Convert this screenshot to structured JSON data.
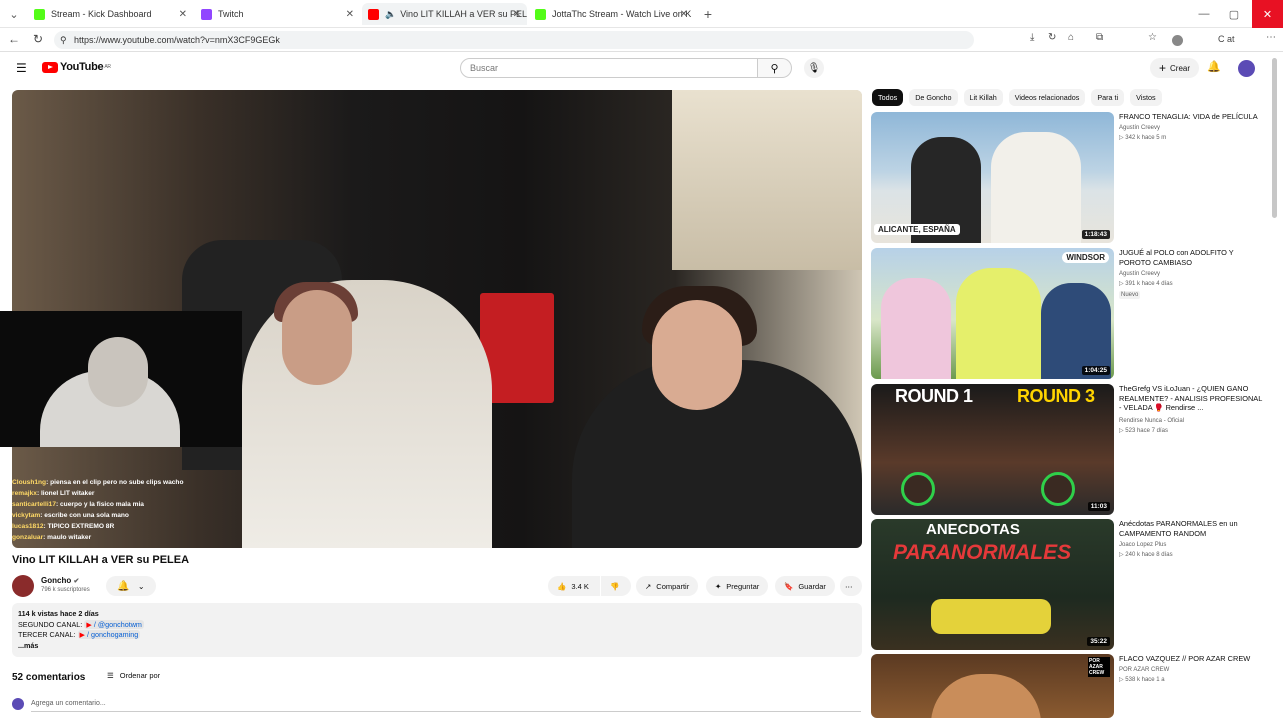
{
  "browser": {
    "tabs": [
      {
        "title": "Stream - Kick Dashboard",
        "favicon": "kick-icon",
        "color": "#53fc18"
      },
      {
        "title": "Twitch",
        "favicon": "twitch-icon",
        "color": "#9146ff"
      },
      {
        "title": "Vino LIT KILLAH a VER su PEL",
        "favicon": "youtube-icon",
        "color": "#ff0000"
      },
      {
        "title": "JottaThc Stream - Watch Live on K",
        "favicon": "kick-icon",
        "color": "#53fc18"
      }
    ],
    "url": "https://www.youtube.com/watch?v=nmX3CF9GEGk",
    "profile_text": "C at"
  },
  "youtube": {
    "logo_text": "YouTube",
    "logo_country": "AR",
    "search_placeholder": "Buscar",
    "create_label": "Crear"
  },
  "video": {
    "title": "Vino LIT KILLAH a VER su PELEA",
    "channel": "Goncho",
    "subscribers": "796 k suscriptores",
    "likes": "3.4 K",
    "share_label": "Compartir",
    "ask_label": "Preguntar",
    "save_label": "Guardar",
    "chat": [
      {
        "user": "Cloush1ng",
        "msg": "piensa en el clip pero no sube clips wacho"
      },
      {
        "user": "remajkx",
        "msg": "lionel LIT witaker"
      },
      {
        "user": "santicartelli17",
        "msg": "cuerpo y la fisico mala mia"
      },
      {
        "user": "vickytam",
        "msg": "escribe con una sola mano"
      },
      {
        "user": "lucas1812",
        "msg": "TIPICO EXTREMO 8R"
      },
      {
        "user": "gonzaluar",
        "msg": "maulo witaker"
      }
    ]
  },
  "description": {
    "views_date": "114 k vistas  hace 2 días",
    "line2_label": "SEGUNDO CANAL:",
    "line2_value": "/ @gonchotwm",
    "line3_label": "TERCER CANAL:",
    "line3_value": "/ gonchogaming",
    "more": "...más"
  },
  "comments": {
    "count_label": "52 comentarios",
    "sort_label": "Ordenar por",
    "add_placeholder": "Agrega un comentario..."
  },
  "chips": [
    "Todos",
    "De Goncho",
    "Lit Killah",
    "Videos relacionados",
    "Para ti",
    "Vistos"
  ],
  "recommendations": [
    {
      "title": "FRANCO TENAGLIA: VIDA de PELÍCULA",
      "channel": "Agustín Creevy",
      "meta": "▷ 342 k  hace 5 m",
      "duration": "1:18:43",
      "thumb_text": "ALICANTE, ESPAÑA",
      "badge": ""
    },
    {
      "title": "JUGUÉ al POLO con ADOLFITO Y POROTO CAMBIASO",
      "channel": "Agustín Creevy",
      "meta": "▷ 391 k  hace 4 días",
      "duration": "1:04:25",
      "thumb_text": "WINDSOR",
      "badge": "Nuevo"
    },
    {
      "title": "TheGrefg VS iLoJuan - ¿QUIEN GANO REALMENTE? - ANALISIS PROFESIONAL - VELADA 🥊 Rendirse ...",
      "channel": "Rendirse Nunca - Oficial",
      "meta": "▷ 523  hace 7 días",
      "duration": "11:03",
      "thumb_text": "ROUND 1",
      "thumb_text2": "ROUND 3",
      "badge": ""
    },
    {
      "title": "Anécdotas PARANORMALES en un CAMPAMENTO RANDOM",
      "channel": "Joaco Lopez Plus",
      "meta": "▷ 240 k  hace 8 días",
      "duration": "35:22",
      "thumb_text": "ANECDOTAS",
      "thumb_text2": "PARANORMALES",
      "badge": ""
    },
    {
      "title": "FLACO VAZQUEZ // POR AZAR CREW",
      "channel": "POR AZAR CREW",
      "meta": "▷ 538 k  hace 1 a",
      "duration": "",
      "thumb_text": "POR AZAR CREW",
      "badge": ""
    }
  ]
}
